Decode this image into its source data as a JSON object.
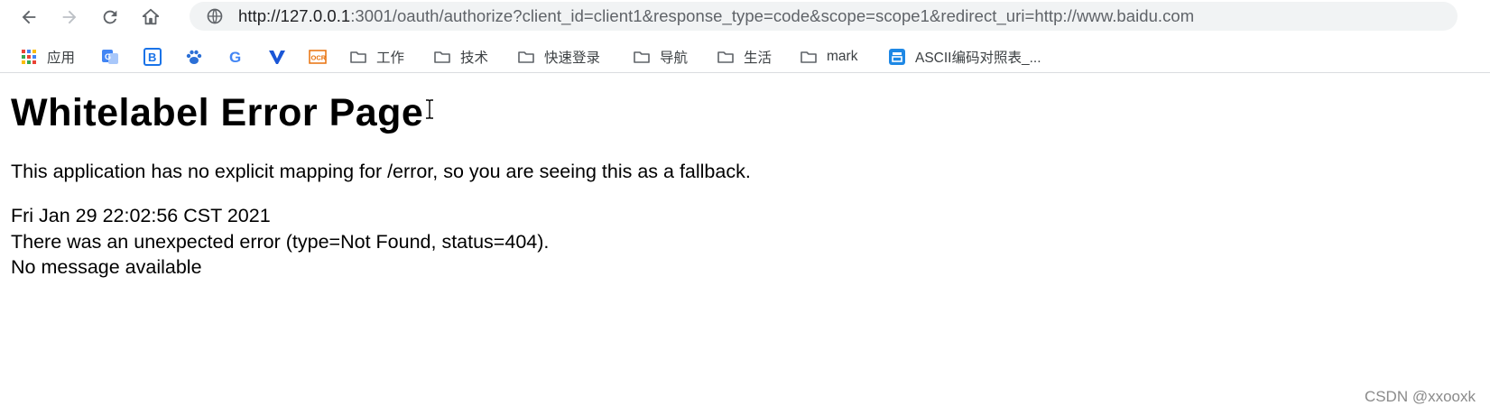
{
  "browser": {
    "url_host": "http://127.0.0.1",
    "url_rest": ":3001/oauth/authorize?client_id=client1&response_type=code&scope=scope1&redirect_uri=http://www.baidu.com",
    "icons": [
      "back-arrow-icon",
      "forward-arrow-icon",
      "reload-icon",
      "home-icon",
      "site-info-icon"
    ]
  },
  "bookmarks": [
    {
      "label": "应用",
      "icon": "apps-grid-icon"
    },
    {
      "label": "",
      "icon": "translate-icon"
    },
    {
      "label": "",
      "icon": "bookmark-b-icon"
    },
    {
      "label": "",
      "icon": "baidu-paw-icon"
    },
    {
      "label": "",
      "icon": "google-g-icon"
    },
    {
      "label": "",
      "icon": "v-logo-icon"
    },
    {
      "label": "",
      "icon": "ocr-icon"
    },
    {
      "label": "工作",
      "icon": "folder-icon"
    },
    {
      "label": "技术",
      "icon": "folder-icon"
    },
    {
      "label": "快速登录",
      "icon": "folder-icon"
    },
    {
      "label": "导航",
      "icon": "folder-icon"
    },
    {
      "label": "生活",
      "icon": "folder-icon"
    },
    {
      "label": "mark",
      "icon": "folder-icon"
    },
    {
      "label": "ASCII编码对照表_...",
      "icon": "ascii-site-icon"
    }
  ],
  "page": {
    "title": "Whitelabel Error Page",
    "description": "This application has no explicit mapping for /error, so you are seeing this as a fallback.",
    "timestamp": "Fri Jan 29 22:02:56 CST 2021",
    "error_line": "There was an unexpected error (type=Not Found, status=404).",
    "message_line": "No message available"
  },
  "watermark": "CSDN @xxooxk",
  "colors": {
    "omnibox_bg": "#f1f3f4",
    "icon_gray": "#5f6368",
    "folder_gray": "#5f6368"
  }
}
